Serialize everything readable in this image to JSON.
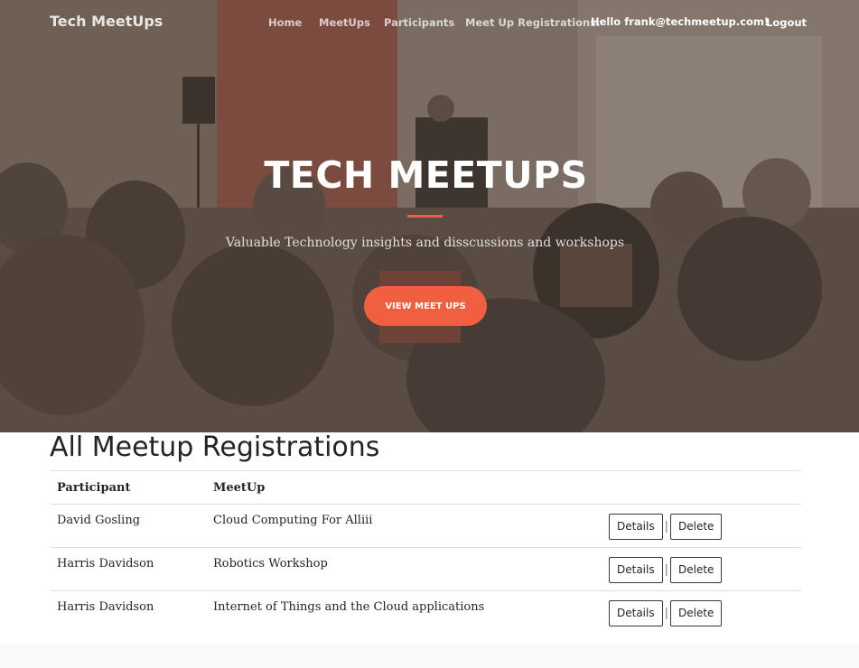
{
  "navbar": {
    "brand": "Tech MeetUps",
    "links": [
      "Home",
      "MeetUps",
      "Participants",
      "Meet Up Registrations."
    ],
    "greeting": "Hello frank@techmeetup.com!",
    "logout": "Logout"
  },
  "hero": {
    "title": "TECH MEETUPS",
    "subtitle": "Valuable Technology insights and disscussions and workshops",
    "cta_label": "VIEW MEET UPS"
  },
  "registrations": {
    "heading": "All Meetup Registrations",
    "columns": [
      "Participant",
      "MeetUp"
    ],
    "rows": [
      {
        "participant": "David Gosling",
        "meetup": "Cloud Computing For Alliii"
      },
      {
        "participant": "Harris Davidson",
        "meetup": "Robotics Workshop"
      },
      {
        "participant": "Harris Davidson",
        "meetup": "Internet of Things and the Cloud applications"
      }
    ],
    "details_label": "Details",
    "separator": "|",
    "delete_label": "Delete"
  },
  "colors": {
    "accent": "#f05f40",
    "hero_overlay": "#5c4d42"
  }
}
